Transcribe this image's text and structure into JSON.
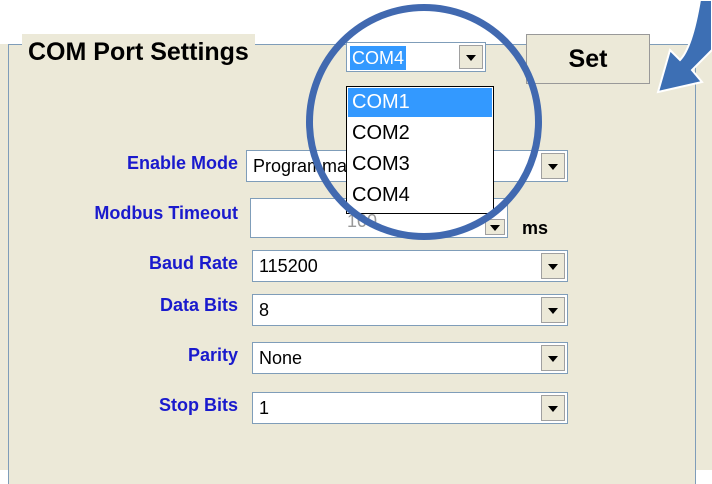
{
  "group_title": "COM Port Settings",
  "com_port": {
    "selected": "COM4",
    "options": [
      "COM1",
      "COM2",
      "COM3",
      "COM4"
    ],
    "highlighted": "COM1"
  },
  "set_label": "Set",
  "fields": {
    "enable_mode": {
      "label": "Enable Mode",
      "value": "Programmable"
    },
    "modbus_timeout": {
      "label": "Modbus Timeout",
      "value": "100",
      "unit": "ms"
    },
    "baud_rate": {
      "label": "Baud Rate",
      "value": "115200"
    },
    "data_bits": {
      "label": "Data Bits",
      "value": "8"
    },
    "parity": {
      "label": "Parity",
      "value": "None"
    },
    "stop_bits": {
      "label": "Stop Bits",
      "value": "1"
    }
  },
  "colors": {
    "label_blue": "#1a1acd",
    "highlight_circle": "#4169b0",
    "selection": "#3399ff",
    "arrow_callout": "#3d6fb4"
  },
  "icons": [
    "dropdown-arrow-icon",
    "callout-arrow-icon"
  ]
}
